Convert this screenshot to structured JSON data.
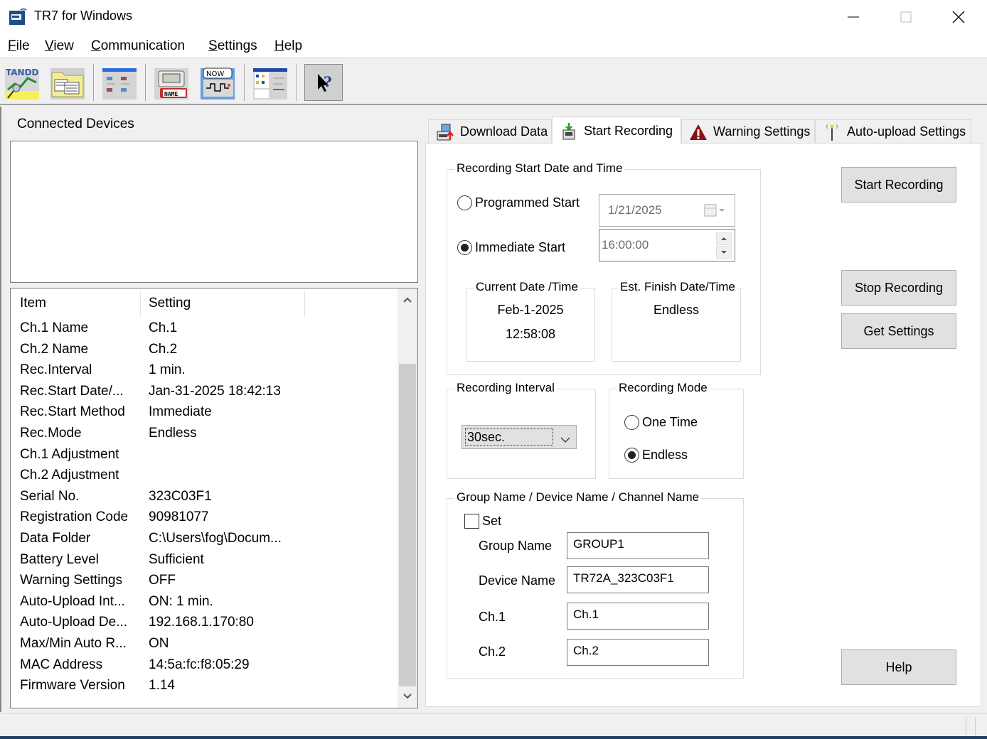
{
  "window": {
    "title": "TR7 for Windows",
    "controls": [
      "minimize",
      "maximize",
      "close"
    ]
  },
  "menubar": {
    "items": [
      {
        "label": "File",
        "accel": "F",
        "rest": "ile"
      },
      {
        "label": "View",
        "accel": "V",
        "rest": "iew"
      },
      {
        "label": "Communication",
        "accel": "C",
        "rest": "ommunication"
      },
      {
        "label": "Settings",
        "accel": "S",
        "rest": "ettings"
      },
      {
        "label": "Help",
        "accel": "H",
        "rest": "elp"
      }
    ]
  },
  "toolbar": {
    "buttons": [
      {
        "name": "tandd-graph-icon"
      },
      {
        "name": "data-folder-icon"
      },
      {
        "name": "window-layout-icon"
      },
      {
        "name": "device-name-tag-icon",
        "badge": "NAME"
      },
      {
        "name": "current-readings-icon",
        "badge": "NOW"
      },
      {
        "name": "settings-window-icon"
      },
      {
        "name": "context-help-icon"
      }
    ]
  },
  "left_panel": {
    "connected_devices_label": "Connected Devices",
    "table": {
      "headers": [
        "Item",
        "Setting"
      ],
      "rows": [
        [
          "Ch.1 Name",
          "Ch.1"
        ],
        [
          "Ch.2 Name",
          "Ch.2"
        ],
        [
          "Rec.Interval",
          "1 min."
        ],
        [
          "Rec.Start Date/...",
          "Jan-31-2025 18:42:13"
        ],
        [
          "Rec.Start Method",
          "Immediate"
        ],
        [
          "Rec.Mode",
          "Endless"
        ],
        [
          "Ch.1 Adjustment",
          ""
        ],
        [
          "Ch.2 Adjustment",
          ""
        ],
        [
          "Serial No.",
          "323C03F1"
        ],
        [
          "Registration Code",
          "90981077"
        ],
        [
          "Data Folder",
          "C:\\Users\\fog\\Docum..."
        ],
        [
          "Battery Level",
          "Sufficient"
        ],
        [
          "Warning Settings",
          "OFF"
        ],
        [
          "Auto-Upload Int...",
          "ON: 1 min."
        ],
        [
          "Auto-Upload De...",
          "192.168.1.170:80"
        ],
        [
          "Max/Min Auto R...",
          "ON"
        ],
        [
          "MAC Address",
          "14:5a:fc:f8:05:29"
        ],
        [
          "Firmware Version",
          "1.14"
        ]
      ]
    }
  },
  "tabs": [
    {
      "label": "Download Data",
      "icon": "download-data-icon",
      "active": false
    },
    {
      "label": "Start Recording",
      "icon": "start-recording-icon",
      "active": true
    },
    {
      "label": "Warning Settings",
      "icon": "warning-icon",
      "active": false
    },
    {
      "label": "Auto-upload Settings",
      "icon": "antenna-icon",
      "active": false
    }
  ],
  "start_recording": {
    "start_group": {
      "legend": "Recording Start Date and Time",
      "programmed_start_label": "Programmed Start",
      "programmed_start_selected": false,
      "immediate_start_label": "Immediate Start",
      "immediate_start_selected": true,
      "date_value": "1/21/2025",
      "time_value": "16:00:00",
      "current_datetime": {
        "legend": "Current Date /Time",
        "date": "Feb-1-2025",
        "time": "12:58:08"
      },
      "est_finish": {
        "legend": "Est. Finish Date/Time",
        "value": "Endless"
      }
    },
    "interval_group": {
      "legend": "Recording Interval",
      "selected": "30sec."
    },
    "mode_group": {
      "legend": "Recording Mode",
      "one_time_label": "One Time",
      "one_time_selected": false,
      "endless_label": "Endless",
      "endless_selected": true
    },
    "names_group": {
      "legend": "Group Name / Device Name / Channel Name",
      "set_label": "Set",
      "set_checked": false,
      "group_name_label": "Group Name",
      "group_name_value": "GROUP1",
      "device_name_label": "Device Name",
      "device_name_value": "TR72A_323C03F1",
      "ch1_label": "Ch.1",
      "ch1_value": "Ch.1",
      "ch2_label": "Ch.2",
      "ch2_value": "Ch.2"
    },
    "buttons": {
      "start_recording": "Start Recording",
      "stop_recording": "Stop Recording",
      "get_settings": "Get Settings",
      "help": "Help"
    }
  }
}
